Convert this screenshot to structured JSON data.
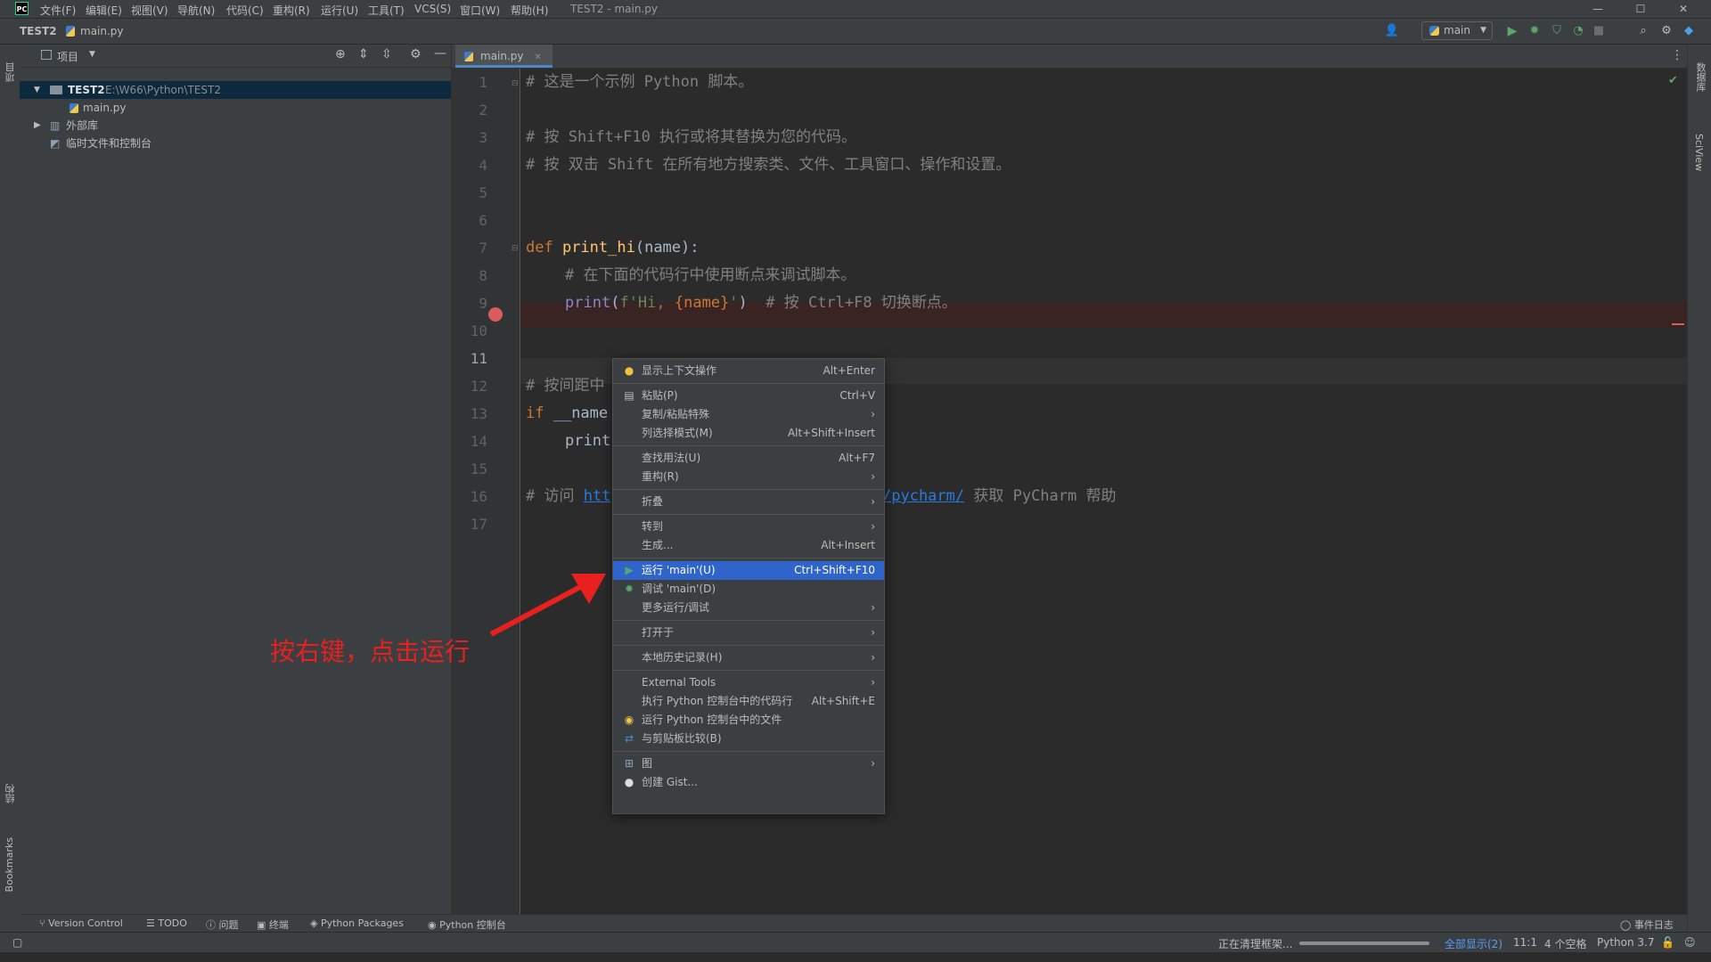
{
  "titlebar": {
    "menus": [
      "文件(F)",
      "编辑(E)",
      "视图(V)",
      "导航(N)",
      "代码(C)",
      "重构(R)",
      "运行(U)",
      "工具(T)",
      "VCS(S)",
      "窗口(W)",
      "帮助(H)"
    ],
    "window_title": "TEST2 - main.py",
    "minimize": "—",
    "maximize": "☐",
    "close": "✕"
  },
  "navbar": {
    "project": "TEST2",
    "file": "main.py",
    "run_config": "main"
  },
  "project_panel": {
    "title": "项目",
    "root_name": "TEST2",
    "root_path": "E:\\W66\\Python\\TEST2",
    "file": "main.py",
    "external_libs": "外部库",
    "scratches": "临时文件和控制台"
  },
  "left_stripe": {
    "project": "项目",
    "structure": "结构",
    "bookmarks": "Bookmarks"
  },
  "right_stripe": {
    "database": "数据库",
    "sciview": "SciView"
  },
  "editor": {
    "tab": "main.py",
    "line_numbers": [
      "1",
      "2",
      "3",
      "4",
      "5",
      "6",
      "7",
      "8",
      "9",
      "10",
      "11",
      "12",
      "13",
      "14",
      "15",
      "16",
      "17"
    ],
    "current_line": "11",
    "code": {
      "l1": "# 这是一个示例 Python 脚本。",
      "l3": "# 按 Shift+F10 执行或将其替换为您的代码。",
      "l4": "# 按 双击 Shift 在所有地方搜索类、文件、工具窗口、操作和设置。",
      "l7_kw": "def ",
      "l7_fn": "print_hi",
      "l7_rest": "(name):",
      "l8": "# 在下面的代码行中使用断点来调试脚本。",
      "l9_bi": "print",
      "l9_open": "(",
      "l9_str": "f'Hi, ",
      "l9_var": "{name}",
      "l9_str2": "'",
      "l9_close": ")  ",
      "l9_cmt": "# 按 Ctrl+F8 切换断点。",
      "l12": "# 按间距中",
      "l13_kw": "if ",
      "l13_rest": "__name",
      "l14": "print",
      "l16_cmt": "# 访问 ",
      "l16_link1": "htt",
      "l16_link2": "/pycharm/",
      "l16_rest": " 获取 PyCharm 帮助"
    }
  },
  "context_menu": {
    "items": [
      {
        "label": "显示上下文操作",
        "shortcut": "Alt+Enter"
      },
      {
        "label": "粘贴(P)",
        "shortcut": "Ctrl+V"
      },
      {
        "label": "复制/粘贴特殊",
        "shortcut": ""
      },
      {
        "label": "列选择模式(M)",
        "shortcut": "Alt+Shift+Insert"
      },
      {
        "label": "查找用法(U)",
        "shortcut": "Alt+F7"
      },
      {
        "label": "重构(R)",
        "shortcut": ""
      },
      {
        "label": "折叠",
        "shortcut": ""
      },
      {
        "label": "转到",
        "shortcut": ""
      },
      {
        "label": "生成...",
        "shortcut": "Alt+Insert"
      },
      {
        "label": "运行 'main'(U)",
        "shortcut": "Ctrl+Shift+F10"
      },
      {
        "label": "调试 'main'(D)",
        "shortcut": ""
      },
      {
        "label": "更多运行/调试",
        "shortcut": ""
      },
      {
        "label": "打开于",
        "shortcut": ""
      },
      {
        "label": "本地历史记录(H)",
        "shortcut": ""
      },
      {
        "label": "External Tools",
        "shortcut": ""
      },
      {
        "label": "执行 Python 控制台中的代码行",
        "shortcut": "Alt+Shift+E"
      },
      {
        "label": "运行 Python 控制台中的文件",
        "shortcut": ""
      },
      {
        "label": "与剪贴板比较(B)",
        "shortcut": ""
      },
      {
        "label": "图",
        "shortcut": ""
      },
      {
        "label": "创建 Gist...",
        "shortcut": ""
      }
    ],
    "submenu_arrow": "›"
  },
  "annotation": {
    "text": "按右键，点击运行",
    "color": "#e8201f"
  },
  "bottom_tools": {
    "version_control": "Version Control",
    "todo": "TODO",
    "problems": "问题",
    "terminal": "终端",
    "python_packages": "Python Packages",
    "python_console": "Python 控制台",
    "event_log": "事件日志"
  },
  "statusbar": {
    "task": "正在清理框架...",
    "show_all": "全部显示(2)",
    "position": "11:1",
    "indent": "4 个空格",
    "interpreter": "Python 3.7"
  },
  "colors": {
    "accent": "#2f65ca",
    "breakpoint": "#db5c5c",
    "run_green": "#59a869"
  }
}
